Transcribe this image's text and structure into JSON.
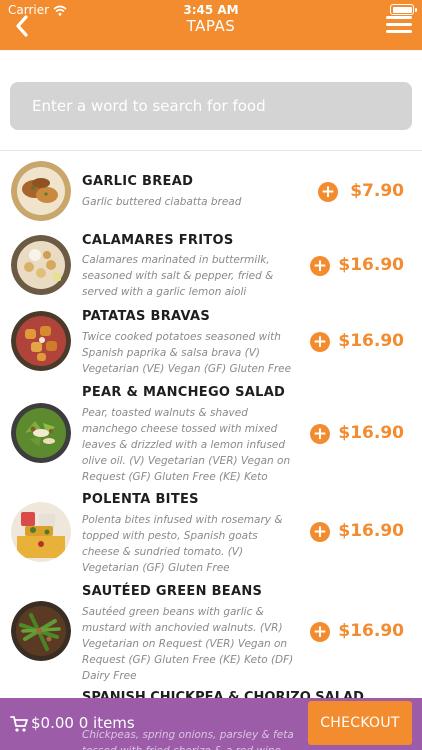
{
  "status_bar": {
    "carrier": "Carrier",
    "time": "3:45 AM"
  },
  "header": {
    "title": "TAPAS"
  },
  "search": {
    "placeholder": "Enter a word to search for food"
  },
  "items": [
    {
      "name": "GARLIC BREAD",
      "description": "Garlic buttered ciabatta bread",
      "price": "$7.90"
    },
    {
      "name": "CALAMARES FRITOS",
      "description": "Calamares marinated in buttermilk, seasoned with salt & pepper, fried & served with a garlic lemon aioli",
      "price": "$16.90"
    },
    {
      "name": "PATATAS BRAVAS",
      "description": "Twice cooked potatoes seasoned with Spanish paprika & salsa brava  (V) Vegetarian (VE) Vegan (GF) Gluten Free",
      "price": "$16.90"
    },
    {
      "name": "PEAR & MANCHEGO SALAD",
      "description": "Pear, toasted walnuts & shaved manchego cheese tossed with mixed leaves & drizzled with a lemon infused olive oil.  (V) Vegetarian (VER) Vegan on Request (GF) Gluten Free (KE) Keto",
      "price": "$16.90"
    },
    {
      "name": "POLENTA BITES",
      "description": "Polenta bites infused with rosemary & topped with pesto, Spanish goats cheese & sundried tomato. (V) Vegetarian (GF) Gluten Free",
      "price": "$16.90"
    },
    {
      "name": "SAUTÉED GREEN BEANS",
      "description": "Sautéed green beans with garlic & mustard with anchovied walnuts. (VR) Vegetarian on Request (VER) Vegan on Request (GF) Gluten Free (KE) Keto (DF) Dairy Free",
      "price": "$16.90"
    },
    {
      "name": "SPANISH CHICKPEA & CHORIZO SALAD",
      "description": "Chickpeas, spring onions, parsley & feta tossed with fried chorizo & a red wine"
    }
  ],
  "cart": {
    "summary": "$0.00 0 items",
    "checkout_label": "CHECKOUT"
  },
  "colors": {
    "accent": "#f28c2f",
    "cart_bar": "#9c5ca8",
    "search_bg": "#d4d4d4"
  }
}
